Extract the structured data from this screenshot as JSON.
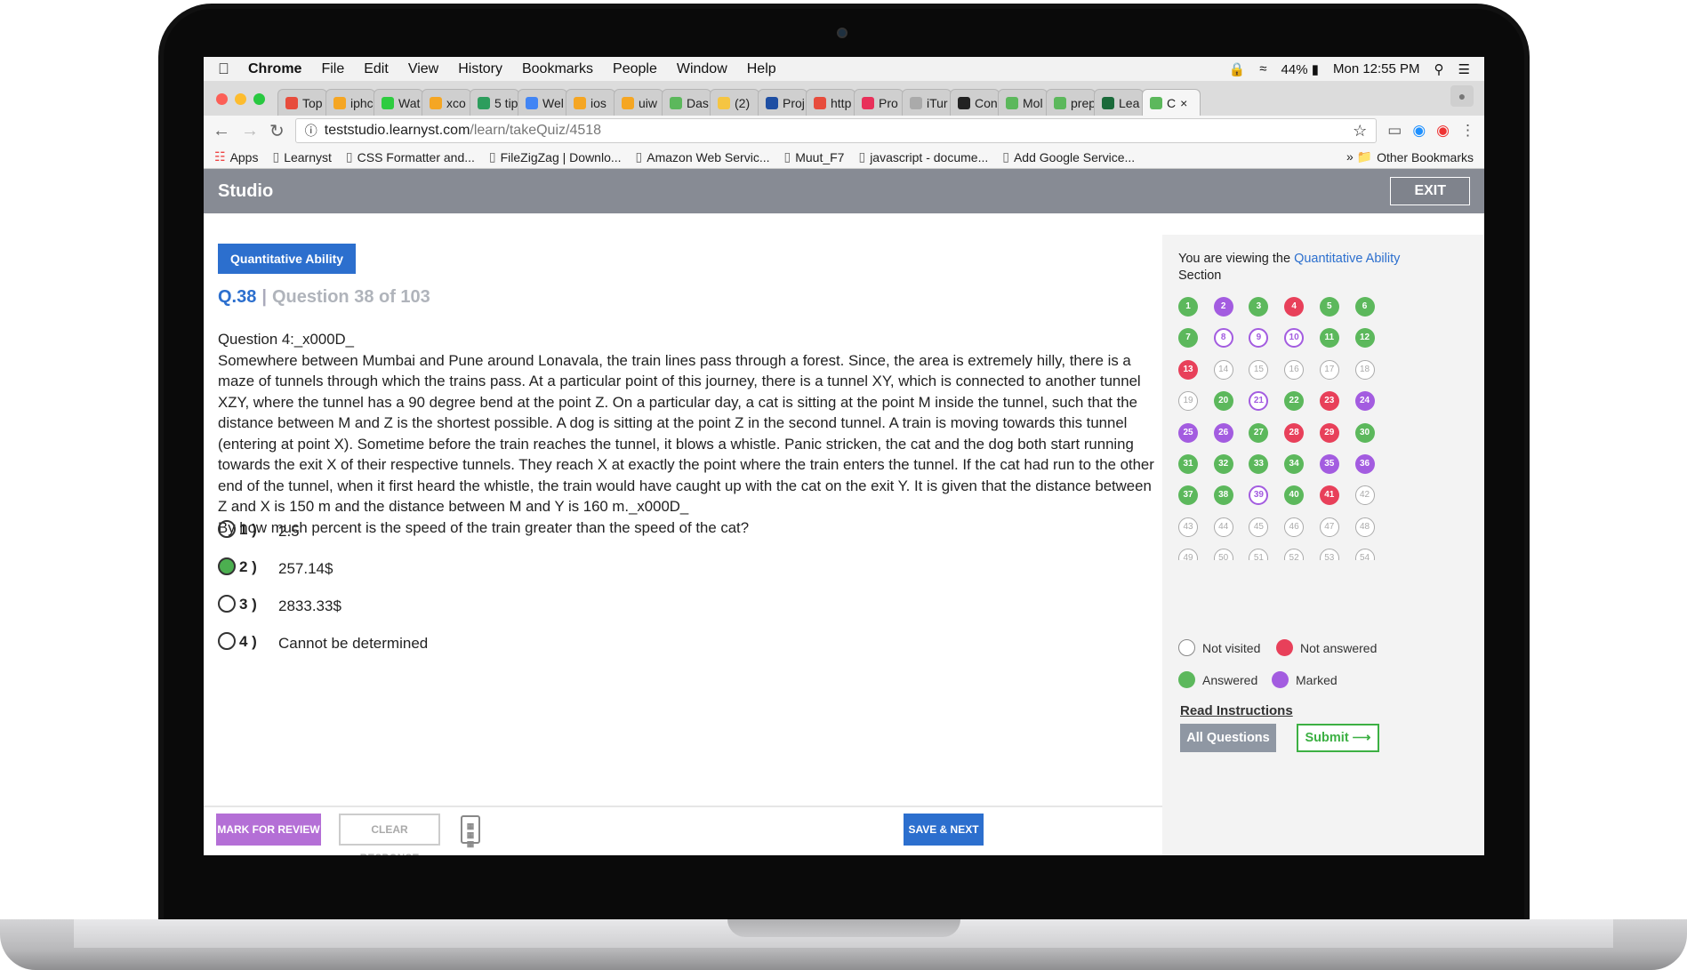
{
  "menubar": {
    "items": [
      "Chrome",
      "File",
      "Edit",
      "View",
      "History",
      "Bookmarks",
      "People",
      "Window",
      "Help"
    ],
    "battery": "44%",
    "clock": "Mon 12:55 PM"
  },
  "tabs": [
    {
      "label": "Top",
      "color": "#e74c3c"
    },
    {
      "label": "iphc",
      "color": "#f5a623"
    },
    {
      "label": "Wat",
      "color": "#2ecc40"
    },
    {
      "label": "xco",
      "color": "#f5a623"
    },
    {
      "label": "5 tip",
      "color": "#2d9d5d"
    },
    {
      "label": "Wel",
      "color": "#4285f4"
    },
    {
      "label": "ios",
      "color": "#f5a623"
    },
    {
      "label": "uiw",
      "color": "#f5a623"
    },
    {
      "label": "Das",
      "color": "#5cb85c"
    },
    {
      "label": "(2)",
      "color": "#f5c542"
    },
    {
      "label": "Proj",
      "color": "#1f4fa3"
    },
    {
      "label": "http",
      "color": "#e74c3c"
    },
    {
      "label": "Pro",
      "color": "#e8305a"
    },
    {
      "label": "iTur",
      "color": "#aaaaaa"
    },
    {
      "label": "Con",
      "color": "#222222"
    },
    {
      "label": "Mol",
      "color": "#5cb85c"
    },
    {
      "label": "prep",
      "color": "#5cb85c"
    },
    {
      "label": "Lea",
      "color": "#1a6a3a"
    },
    {
      "label": "C",
      "color": "#5cb85c",
      "active": true
    }
  ],
  "address": {
    "domain": "teststudio.learnyst.com",
    "path": "/learn/takeQuiz/4518"
  },
  "bookmarks": [
    "Apps",
    "Learnyst",
    "CSS Formatter and...",
    "FileZigZag | Downlo...",
    "Amazon Web Servic...",
    "Muut_F7",
    "javascript - docume...",
    "Add Google Service..."
  ],
  "other_bookmarks": "Other Bookmarks",
  "header": {
    "title": "Studio",
    "exit": "EXIT"
  },
  "quiz": {
    "section": "Quantitative Ability",
    "qnum": "Q.38",
    "qof": "Question 38 of 103",
    "title": "Question 4:_x000D_",
    "passage": "Somewhere between Mumbai and Pune around Lonavala, the train lines pass through a forest. Since, the area is extremely hilly, there is a maze of tunnels through which the trains pass. At a particular point of this journey, there is a tunnel XY, which is connected to another tunnel XZY, where the tunnel has a 90 degree bend at the point Z. On a particular day, a cat is sitting at the point M inside the tunnel, such that the distance between M and Z is the shortest possible. A dog is sitting at the point Z in the second tunnel. A train is moving towards this tunnel (entering at point X). Sometime before the train reaches the tunnel, it blows a whistle. Panic stricken, the cat and the dog both start running towards the exit X of their respective tunnels. They reach X at exactly the point where the train enters the tunnel. If the cat had run to the other end of the tunnel, when it first heard the whistle, the train would have caught up with the cat on the exit Y. It is given that the distance between Z and X is 150 m and the distance between M and Y is 160 m._x000D_",
    "question": "By how much percent is the speed of the train greater than the speed of the cat?",
    "options": [
      {
        "num": "1 )",
        "value": "2.5",
        "selected": false
      },
      {
        "num": "2 )",
        "value": "257.14$",
        "selected": true
      },
      {
        "num": "3 )",
        "value": "2833.33$",
        "selected": false
      },
      {
        "num": "4 )",
        "value": "Cannot be determined",
        "selected": false
      }
    ]
  },
  "footer": {
    "mark": "MARK FOR REVIEW",
    "clear": "CLEAR RESPONSE",
    "save": "SAVE & NEXT"
  },
  "sidebar": {
    "viewing_prefix": "You are viewing the",
    "viewing_section": "Quantitative Ability",
    "viewing_suffix": "Section",
    "statuses": [
      "answered",
      "marked",
      "answered",
      "notans",
      "answered",
      "answered",
      "answered",
      "marked-empty",
      "marked-empty",
      "marked-empty",
      "answered",
      "answered",
      "notans",
      "notvisited",
      "notvisited",
      "notvisited",
      "notvisited",
      "notvisited",
      "notvisited",
      "answered",
      "marked-empty",
      "answered",
      "notans",
      "marked",
      "marked",
      "marked",
      "answered",
      "notans",
      "notans",
      "answered",
      "answered",
      "answered",
      "answered",
      "answered",
      "marked",
      "marked",
      "answered",
      "answered",
      "marked-empty",
      "answered",
      "notans",
      "notvisited",
      "notvisited",
      "notvisited",
      "notvisited",
      "notvisited",
      "notvisited",
      "notvisited",
      "notvisited",
      "notvisited",
      "notvisited",
      "notvisited",
      "notvisited",
      "notvisited"
    ],
    "legend": {
      "not_visited": "Not visited",
      "not_answered": "Not answered",
      "answered": "Answered",
      "marked": "Marked"
    },
    "read_instructions": "Read Instructions",
    "all_questions": "All Questions",
    "submit": "Submit ⟶"
  },
  "colors": {
    "accent": "#2c6fce",
    "answered": "#5cb85c",
    "not_answered": "#e8405a",
    "marked": "#a35ce0",
    "header": "#878b94"
  }
}
